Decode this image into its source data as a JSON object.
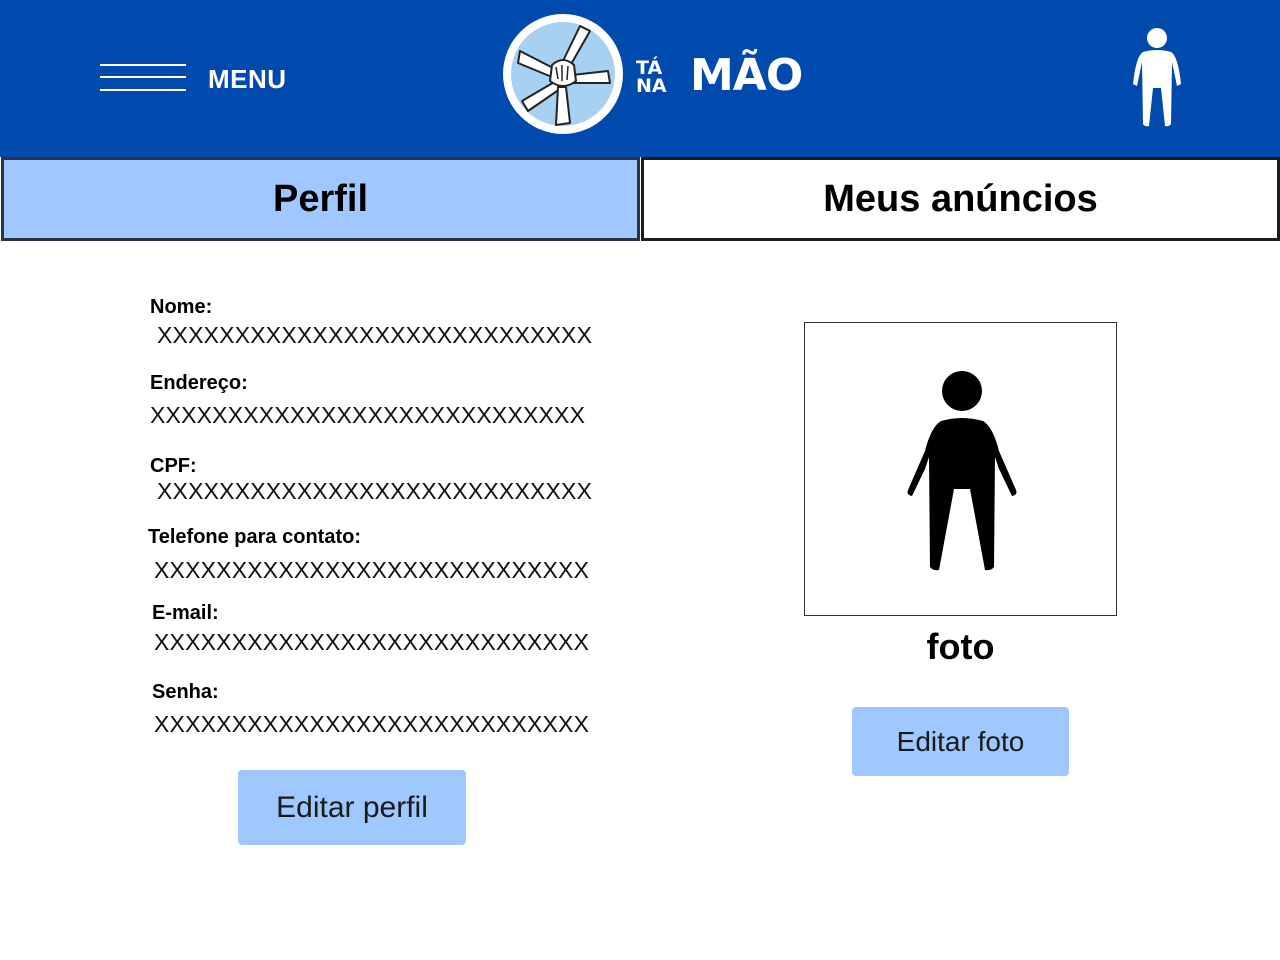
{
  "header": {
    "menu_label": "MENU",
    "logo": {
      "small_top": "TÁ",
      "small_bottom": "NA",
      "big": "MÃO"
    },
    "user_icon": "person-icon"
  },
  "tabs": [
    {
      "label": "Perfil",
      "active": true
    },
    {
      "label": "Meus anúncios",
      "active": false
    }
  ],
  "profile": {
    "fields": [
      {
        "label": "Nome:",
        "value": "XXXXXXXXXXXXXXXXXXXXXXXXXXXX"
      },
      {
        "label": "Endereço:",
        "value": "XXXXXXXXXXXXXXXXXXXXXXXXXXXX"
      },
      {
        "label": "CPF:",
        "value": "XXXXXXXXXXXXXXXXXXXXXXXXXXXX"
      },
      {
        "label": "Telefone para contato:",
        "value": "XXXXXXXXXXXXXXXXXXXXXXXXXXXX"
      },
      {
        "label": "E-mail:",
        "value": "XXXXXXXXXXXXXXXXXXXXXXXXXXXX"
      },
      {
        "label": "Senha:",
        "value": "XXXXXXXXXXXXXXXXXXXXXXXXXXXX"
      }
    ],
    "edit_button": "Editar perfil"
  },
  "photo": {
    "caption": "foto",
    "placeholder_icon": "person-icon",
    "edit_button": "Editar foto"
  },
  "colors": {
    "header_bg": "#004aad",
    "accent": "#a0c8ff",
    "logo_circle_bg": "#a8d0f0"
  }
}
